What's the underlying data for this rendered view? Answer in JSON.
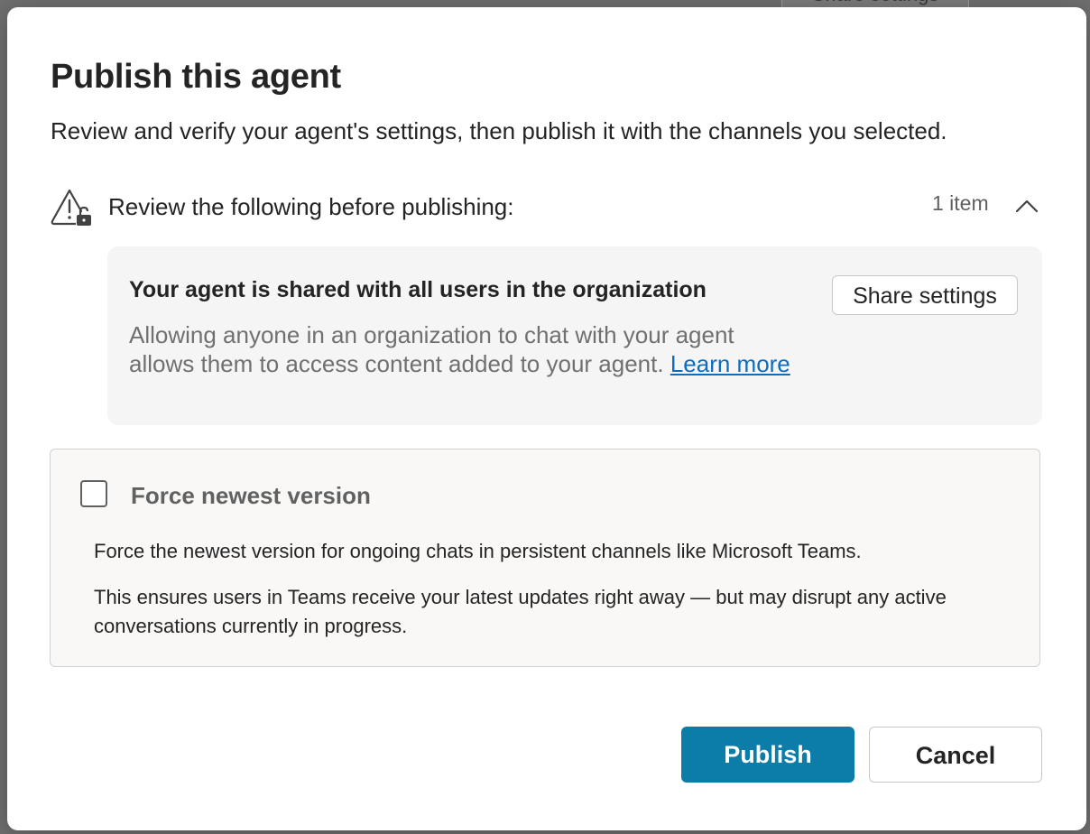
{
  "background": {
    "share_button_label": "Share settings"
  },
  "dialog": {
    "title": "Publish this agent",
    "subtitle": "Review and verify your agent's settings, then publish it with the channels you selected."
  },
  "review": {
    "label": "Review the following before publishing:",
    "count": "1 item",
    "icon": "warning-lock-icon",
    "expanded": true
  },
  "notice": {
    "title": "Your agent is shared with all users in the organization",
    "body": "Allowing anyone in an organization to chat with your agent allows them to access content added to your agent. ",
    "link_text": "Learn more",
    "share_button_label": "Share settings"
  },
  "force": {
    "label": "Force newest version",
    "checked": false,
    "description_1": "Force the newest version for ongoing chats in persistent channels like Microsoft Teams.",
    "description_2": "This ensures users in Teams receive your latest updates right away — but may disrupt any active conversations currently in progress."
  },
  "actions": {
    "publish_label": "Publish",
    "cancel_label": "Cancel"
  },
  "colors": {
    "primary": "#0c7ca8",
    "link": "#0f6cbd",
    "notice_bg": "#f5f5f5"
  }
}
